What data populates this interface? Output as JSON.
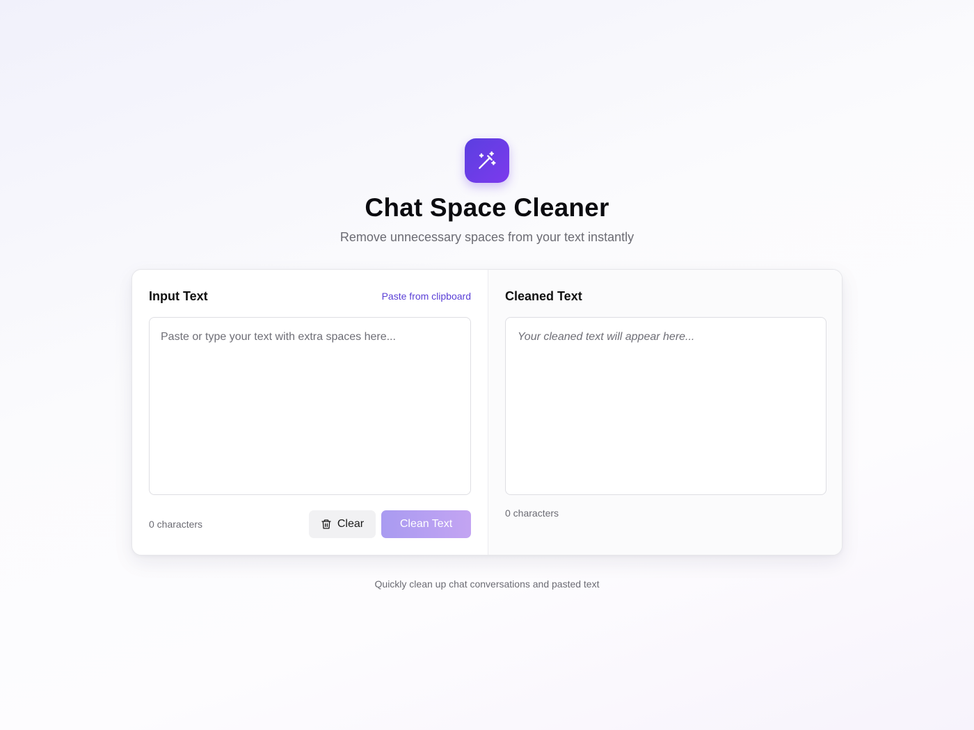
{
  "app": {
    "title": "Chat Space Cleaner",
    "subtitle": "Remove unnecessary spaces from your text instantly",
    "logo_icon": "magic-wand-icon",
    "accent_color": "#6d3be8"
  },
  "input_panel": {
    "title": "Input Text",
    "paste_link": "Paste from clipboard",
    "placeholder": "Paste or type your text with extra spaces here...",
    "value": "",
    "char_count": "0 characters",
    "clear_label": "Clear",
    "clear_icon": "trash-icon",
    "clean_label": "Clean Text"
  },
  "output_panel": {
    "title": "Cleaned Text",
    "placeholder": "Your cleaned text will appear here...",
    "char_count": "0 characters"
  },
  "footer": {
    "note": "Quickly clean up chat conversations and pasted text"
  }
}
